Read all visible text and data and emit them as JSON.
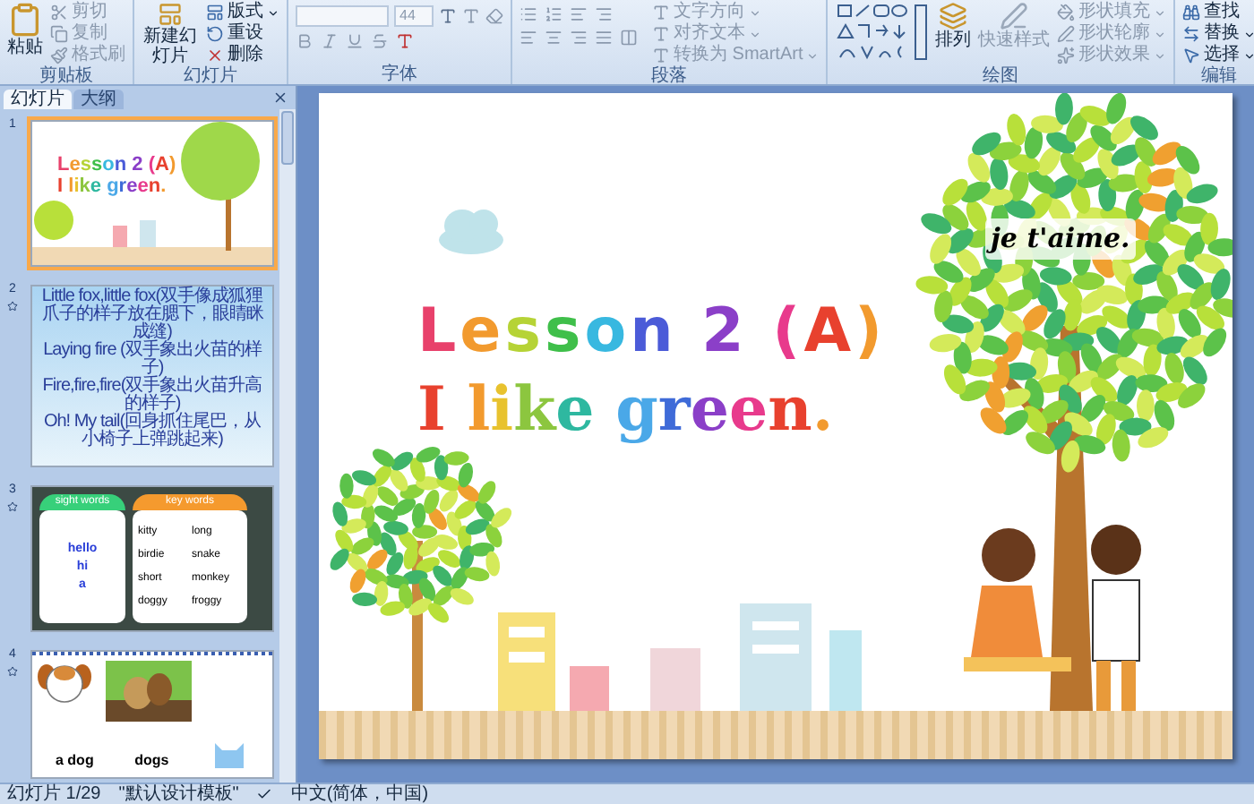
{
  "ribbon": {
    "groups": [
      {
        "kind": "clipboard",
        "label": "剪贴板",
        "commands": [
          {
            "label": "粘贴",
            "disabled": false
          },
          {
            "label": "剪切",
            "disabled": true
          },
          {
            "label": "复制",
            "disabled": true
          },
          {
            "label": "格式刷",
            "disabled": true
          }
        ]
      },
      {
        "kind": "slides",
        "label": "幻灯片",
        "commands": [
          {
            "label": "新建幻灯片",
            "disabled": false
          },
          {
            "label": "版式",
            "disabled": false
          },
          {
            "label": "重设",
            "disabled": false
          },
          {
            "label": "删除",
            "disabled": false
          }
        ]
      },
      {
        "kind": "font",
        "label": "字体",
        "font_size": "44"
      },
      {
        "kind": "paragraph",
        "label": "段落",
        "commands": [
          {
            "label": "文字方向",
            "disabled": true
          },
          {
            "label": "对齐文本",
            "disabled": true
          },
          {
            "label": "转换为 SmartArt",
            "disabled": true
          }
        ]
      },
      {
        "kind": "drawing",
        "label": "绘图",
        "commands": [
          {
            "label": "排列",
            "disabled": false
          },
          {
            "label": "快速样式",
            "disabled": true
          },
          {
            "label": "形状填充",
            "disabled": true
          },
          {
            "label": "形状轮廓",
            "disabled": true
          },
          {
            "label": "形状效果",
            "disabled": true
          }
        ]
      },
      {
        "kind": "editing",
        "label": "编辑",
        "commands": [
          {
            "label": "查找",
            "disabled": false
          },
          {
            "label": "替换",
            "disabled": false
          },
          {
            "label": "选择",
            "disabled": false
          }
        ]
      }
    ]
  },
  "pane": {
    "tabs": [
      {
        "label": "幻灯片",
        "selected": true
      },
      {
        "label": "大纲",
        "selected": false
      }
    ],
    "thumbnails": [
      {
        "number": "1",
        "kind": "title",
        "selected": true,
        "lines": [
          "Lesson 2 (A)",
          "I like green."
        ]
      },
      {
        "number": "2",
        "kind": "text",
        "selected": false,
        "lines": [
          "Little fox,little fox(双手像成狐狸爪子的样子放在腮下，眼睛眯成缝)",
          "Laying fire (双手象出火苗的样子)",
          "Fire,fire,fire(双手象出火苗升高的样子)",
          "Oh! My tail(回身抓住尾巴，从小椅子上弹跳起来)"
        ]
      },
      {
        "number": "3",
        "kind": "words",
        "selected": false,
        "headers": [
          "sight words",
          "key words"
        ],
        "left_words": [
          "hello",
          "hi",
          "a"
        ],
        "right_words": [
          "kitty",
          "long",
          "birdie",
          "snake",
          "short",
          "monkey",
          "doggy",
          "froggy"
        ]
      },
      {
        "number": "4",
        "kind": "pictures",
        "selected": false,
        "captions": [
          "a dog",
          "dogs"
        ]
      }
    ]
  },
  "slide": {
    "title_lines": [
      {
        "text": "Lesson 2 (A)",
        "letters": [
          {
            "color": "#e8416b"
          },
          {
            "color": "#f29a2e"
          },
          {
            "color": "#b6d336"
          },
          {
            "color": "#3fbf4a"
          },
          {
            "color": "#38b8e0"
          },
          {
            "color": "#4b5bd8"
          },
          {
            "color": "#8b3fc8"
          },
          {
            "color": "#e83a8c"
          },
          {
            "color": "#e8412e"
          },
          {
            "color": "#f29a2e"
          }
        ]
      },
      {
        "text": "I like green.",
        "letters": [
          {
            "color": "#e8412e"
          },
          {
            "color": "#f29a2e"
          },
          {
            "color": "#e8c22e"
          },
          {
            "color": "#8cc63f"
          },
          {
            "color": "#2eb8a0"
          },
          {
            "color": "#4aa8e8"
          },
          {
            "color": "#3f6bd8"
          },
          {
            "color": "#8b3fc8"
          },
          {
            "color": "#e83a8c"
          },
          {
            "color": "#e8412e"
          },
          {
            "color": "#f29a2e"
          }
        ]
      }
    ],
    "signature": "je t'aime."
  },
  "status_bar": {
    "slide_counter": "幻灯片 1/29",
    "theme": "\"默认设计模板\"",
    "language": "中文(简体，中国)"
  }
}
